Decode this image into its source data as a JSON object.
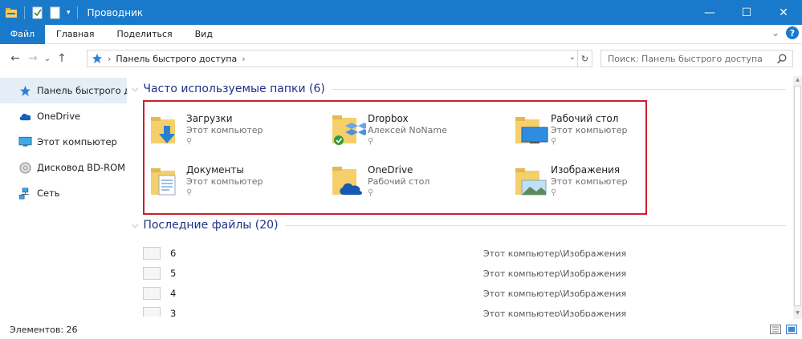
{
  "window": {
    "title": "Проводник",
    "minimize": "—",
    "maximize": "☐",
    "close": "✕"
  },
  "ribbon": {
    "tabs": [
      "Файл",
      "Главная",
      "Поделиться",
      "Вид"
    ],
    "expand": "⌄",
    "help": "?"
  },
  "nav": {
    "back": "←",
    "forward": "→",
    "recent": "⌄",
    "up": "↑",
    "breadcrumb": "Панель быстрого доступа",
    "breadcrumb_sep": "›",
    "dropdown": "⌄",
    "refresh": "↻",
    "search_placeholder": "Поиск: Панель быстрого доступа"
  },
  "sidebar": {
    "items": [
      {
        "label": "Панель быстрого доступа",
        "icon": "star-icon"
      },
      {
        "label": "OneDrive",
        "icon": "cloud-icon"
      },
      {
        "label": "Этот компьютер",
        "icon": "monitor-icon"
      },
      {
        "label": "Дисковод BD-ROM (",
        "icon": "disc-icon"
      },
      {
        "label": "Сеть",
        "icon": "network-icon"
      }
    ]
  },
  "frequent": {
    "header": "Часто используемые папки (6)",
    "folders": [
      {
        "name": "Загрузки",
        "location": "Этот компьютер",
        "icon": "downloads-folder-icon"
      },
      {
        "name": "Dropbox",
        "location": "Алексей NoName",
        "icon": "dropbox-folder-icon"
      },
      {
        "name": "Рабочий стол",
        "location": "Этот компьютер",
        "icon": "desktop-folder-icon"
      },
      {
        "name": "Документы",
        "location": "Этот компьютер",
        "icon": "documents-folder-icon"
      },
      {
        "name": "OneDrive",
        "location": "Рабочий стол",
        "icon": "onedrive-folder-icon"
      },
      {
        "name": "Изображения",
        "location": "Этот компьютер",
        "icon": "pictures-folder-icon"
      }
    ],
    "pin": "⚲"
  },
  "recent": {
    "header": "Последние файлы (20)",
    "files": [
      {
        "name": "6",
        "path": "Этот компьютер\\Изображения"
      },
      {
        "name": "5",
        "path": "Этот компьютер\\Изображения"
      },
      {
        "name": "4",
        "path": "Этот компьютер\\Изображения"
      },
      {
        "name": "3",
        "path": "Этот компьютер\\Изображения"
      }
    ]
  },
  "status": {
    "count": "Элементов: 26"
  },
  "colors": {
    "accent": "#1979ca",
    "highlight_border": "#cc1f2e",
    "folder_yellow": "#f4cf6a"
  }
}
